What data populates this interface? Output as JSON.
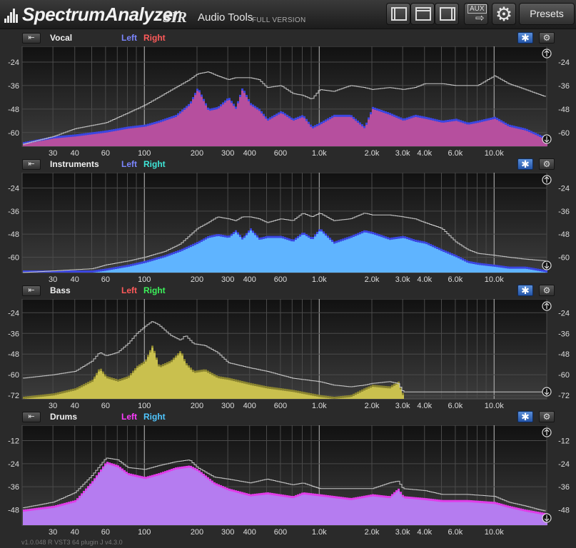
{
  "app": {
    "name": "SpectrumAnalyzer",
    "brand": "SIR",
    "subtitle": "Audio Tools",
    "edition": "FULL VERSION",
    "presets_label": "Presets",
    "aux_label": "AUX",
    "version": "v1.0.048 R VST3 64  plugin J v4.3.0"
  },
  "freq_ticks": [
    "30",
    "40",
    "60",
    "100",
    "200",
    "300",
    "400",
    "600",
    "1.0k",
    "2.0k",
    "3.0k",
    "4.0k",
    "6.0k",
    "10.0k"
  ],
  "freq_tick_values": [
    30,
    40,
    60,
    100,
    200,
    300,
    400,
    600,
    1000,
    2000,
    3000,
    4000,
    6000,
    10000
  ],
  "panels": [
    {
      "name": "Vocal",
      "left_label": "Left",
      "right_label": "Right",
      "left_color": "#7b86ff",
      "right_color": "#ff5a5a",
      "fill_main": "#b64f9e",
      "fill_back": "#3b46e0",
      "db_ticks": [
        "-24",
        "-36",
        "-48",
        "-60"
      ],
      "db_values": [
        -24,
        -36,
        -48,
        -60
      ],
      "db_range": [
        -67,
        -16
      ],
      "chart_data": {
        "type": "area",
        "x": [
          20,
          30,
          40,
          60,
          80,
          100,
          120,
          150,
          180,
          200,
          230,
          260,
          300,
          330,
          360,
          400,
          450,
          500,
          600,
          700,
          800,
          900,
          1000,
          1200,
          1500,
          1800,
          2000,
          2500,
          3000,
          3500,
          4000,
          5000,
          6000,
          7000,
          8000,
          10000,
          12000,
          15000,
          20000
        ],
        "values": [
          -66,
          -63,
          -62,
          -60,
          -58,
          -57,
          -55,
          -52,
          -46,
          -38,
          -49,
          -48,
          -43,
          -48,
          -38,
          -46,
          -49,
          -54,
          -50,
          -54,
          -52,
          -58,
          -56,
          -52,
          -52,
          -58,
          -48,
          -51,
          -54,
          -52,
          -53,
          -55,
          -54,
          -56,
          -55,
          -53,
          -57,
          -59,
          -64
        ],
        "peak_hold": [
          -66,
          -62,
          -58,
          -55,
          -50,
          -46,
          -42,
          -37,
          -33,
          -30,
          -29,
          -31,
          -33,
          -32,
          -32,
          -32,
          -33,
          -37,
          -36,
          -40,
          -41,
          -43,
          -38,
          -39,
          -36,
          -37,
          -38,
          -37,
          -38,
          -37,
          -35,
          -35,
          -36,
          -36,
          -36,
          -31,
          -35,
          -38,
          -42
        ]
      }
    },
    {
      "name": "Instruments",
      "left_label": "Left",
      "right_label": "Right",
      "left_color": "#7b86ff",
      "right_color": "#3fe6d8",
      "fill_main": "#5fb4ff",
      "fill_back": "#3b46e0",
      "db_ticks": [
        "-24",
        "-36",
        "-48",
        "-60"
      ],
      "db_values": [
        -24,
        -36,
        -48,
        -60
      ],
      "db_range": [
        -68,
        -16
      ],
      "chart_data": {
        "type": "area",
        "x": [
          20,
          50,
          60,
          80,
          100,
          130,
          160,
          200,
          230,
          260,
          300,
          330,
          360,
          400,
          450,
          500,
          600,
          700,
          800,
          900,
          1000,
          1200,
          1500,
          1800,
          2000,
          2500,
          3000,
          3500,
          4000,
          5000,
          6000,
          7000,
          8000,
          10000,
          12000,
          15000,
          20000
        ],
        "values": [
          -68,
          -68,
          -67,
          -65,
          -63,
          -60,
          -57,
          -53,
          -50,
          -49,
          -50,
          -47,
          -51,
          -46,
          -51,
          -50,
          -50,
          -52,
          -48,
          -51,
          -46,
          -53,
          -50,
          -47,
          -48,
          -51,
          -50,
          -52,
          -53,
          -57,
          -60,
          -63,
          -64,
          -65,
          -66,
          -66,
          -68
        ],
        "peak_hold": [
          -68,
          -66,
          -64,
          -62,
          -60,
          -57,
          -53,
          -45,
          -42,
          -39,
          -40,
          -41,
          -39,
          -39,
          -40,
          -42,
          -40,
          -41,
          -37,
          -39,
          -37,
          -41,
          -40,
          -37,
          -38,
          -38,
          -39,
          -40,
          -42,
          -45,
          -52,
          -56,
          -58,
          -59,
          -60,
          -61,
          -62
        ]
      }
    },
    {
      "name": "Bass",
      "left_label": "Left",
      "right_label": "Right",
      "left_color": "#ff5a5a",
      "right_color": "#3cf25a",
      "fill_main": "#c9c04e",
      "fill_back": "#8a8430",
      "db_ticks": [
        "-24",
        "-36",
        "-48",
        "-60",
        "-72"
      ],
      "db_values": [
        -24,
        -36,
        -48,
        -60,
        -72
      ],
      "db_range": [
        -74,
        -16
      ],
      "chart_data": {
        "type": "area",
        "x": [
          20,
          30,
          40,
          50,
          55,
          60,
          70,
          80,
          90,
          100,
          110,
          120,
          140,
          160,
          170,
          190,
          220,
          260,
          300,
          400,
          500,
          700,
          1000,
          1200,
          1500,
          1800,
          2000,
          2500,
          2800,
          3000
        ],
        "values": [
          -74,
          -72,
          -69,
          -64,
          -57,
          -62,
          -64,
          -62,
          -56,
          -53,
          -44,
          -56,
          -53,
          -47,
          -54,
          -59,
          -58,
          -62,
          -63,
          -66,
          -68,
          -70,
          -73,
          -74,
          -73,
          -69,
          -67,
          -68,
          -65,
          -73
        ],
        "peak_hold": [
          -62,
          -60,
          -58,
          -52,
          -47,
          -49,
          -47,
          -42,
          -36,
          -32,
          -29,
          -31,
          -37,
          -40,
          -37,
          -42,
          -43,
          -47,
          -53,
          -56,
          -58,
          -62,
          -64,
          -66,
          -67,
          -66,
          -65,
          -64,
          -65,
          -70
        ]
      }
    },
    {
      "name": "Drums",
      "left_label": "Left",
      "right_label": "Right",
      "left_color": "#ff3cff",
      "right_color": "#4fc6ff",
      "fill_main": "#b57cf0",
      "fill_back": "#e03ce8",
      "db_ticks": [
        "-12",
        "-24",
        "-36",
        "-48"
      ],
      "db_values": [
        -12,
        -24,
        -36,
        -48
      ],
      "db_range": [
        -56,
        -4
      ],
      "chart_data": {
        "type": "area",
        "x": [
          20,
          30,
          40,
          50,
          60,
          70,
          80,
          100,
          120,
          150,
          180,
          200,
          250,
          300,
          400,
          500,
          700,
          800,
          1000,
          1500,
          2000,
          2500,
          2800,
          3000,
          4000,
          5000,
          7000,
          10000,
          12000,
          15000,
          20000
        ],
        "values": [
          -49,
          -47,
          -44,
          -34,
          -24,
          -26,
          -30,
          -32,
          -30,
          -27,
          -26,
          -28,
          -35,
          -38,
          -41,
          -40,
          -42,
          -40,
          -41,
          -43,
          -41,
          -42,
          -38,
          -42,
          -43,
          -44,
          -44,
          -45,
          -47,
          -49,
          -51
        ],
        "peak_hold": [
          -47,
          -44,
          -39,
          -30,
          -21,
          -22,
          -26,
          -27,
          -25,
          -23,
          -22,
          -26,
          -31,
          -32,
          -34,
          -32,
          -35,
          -34,
          -37,
          -37,
          -37,
          -34,
          -33,
          -37,
          -38,
          -40,
          -40,
          -41,
          -44,
          -46,
          -49
        ]
      }
    }
  ]
}
